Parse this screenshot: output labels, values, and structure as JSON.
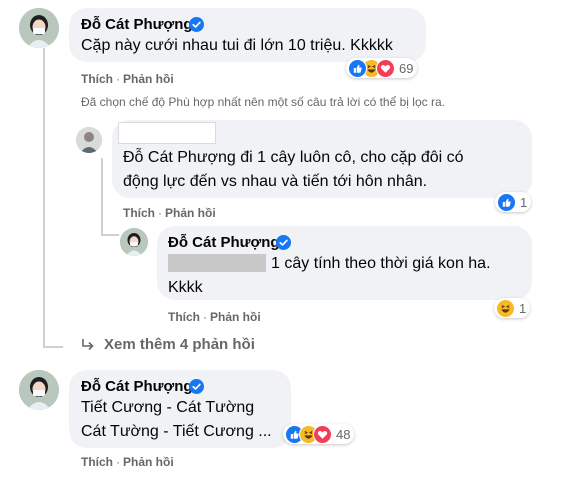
{
  "colors": {
    "bubble": "#f0f2f5",
    "meta_text": "#65676b",
    "like_blue": "#1877f2",
    "haha_yellow": "#f7b928",
    "love_red": "#f33e58",
    "thread_line": "#ced0d4"
  },
  "comment1": {
    "author": "Đỗ Cát Phượng",
    "verified_icon": "verified-badge-icon",
    "text": "Cặp này cưới nhau tui đi lớn 10 triệu. Kkkkk",
    "actions": {
      "like": "Thích",
      "reply": "Phản hồi"
    },
    "reactions": {
      "icons": [
        "like-reaction-icon",
        "haha-reaction-icon",
        "love-reaction-icon"
      ],
      "count": "69"
    }
  },
  "filter_notice": "Đã chọn chế độ Phù hợp nhất nên một số câu trả lời có thể bị lọc ra.",
  "reply1": {
    "text_line1": "Đỗ Cát Phượng đi 1 cây luôn cô, cho cặp đôi có",
    "text_line2": "động lực đến vs nhau và tiến tới hôn nhân.",
    "actions": {
      "like": "Thích",
      "reply": "Phản hồi"
    },
    "reactions": {
      "icons": [
        "like-reaction-icon"
      ],
      "count": "1"
    }
  },
  "reply2": {
    "author": "Đỗ Cát Phượng",
    "verified_icon": "verified-badge-icon",
    "text_line1": "1 cây tính theo thời giá kon ha.",
    "text_line2": "Kkkk",
    "actions": {
      "like": "Thích",
      "reply": "Phản hồi"
    },
    "reactions": {
      "icons": [
        "haha-reaction-icon"
      ],
      "count": "1"
    }
  },
  "more_replies": {
    "icon": "reply-arrow-icon",
    "label": "Xem thêm 4 phản hồi"
  },
  "comment2": {
    "author": "Đỗ Cát Phượng",
    "verified_icon": "verified-badge-icon",
    "text_line1": "Tiết Cương - Cát Tường",
    "text_line2": "Cát Tường - Tiết Cương ...",
    "actions": {
      "like": "Thích",
      "reply": "Phản hồi"
    },
    "reactions": {
      "icons": [
        "like-reaction-icon",
        "haha-reaction-icon",
        "love-reaction-icon"
      ],
      "count": "48"
    }
  }
}
